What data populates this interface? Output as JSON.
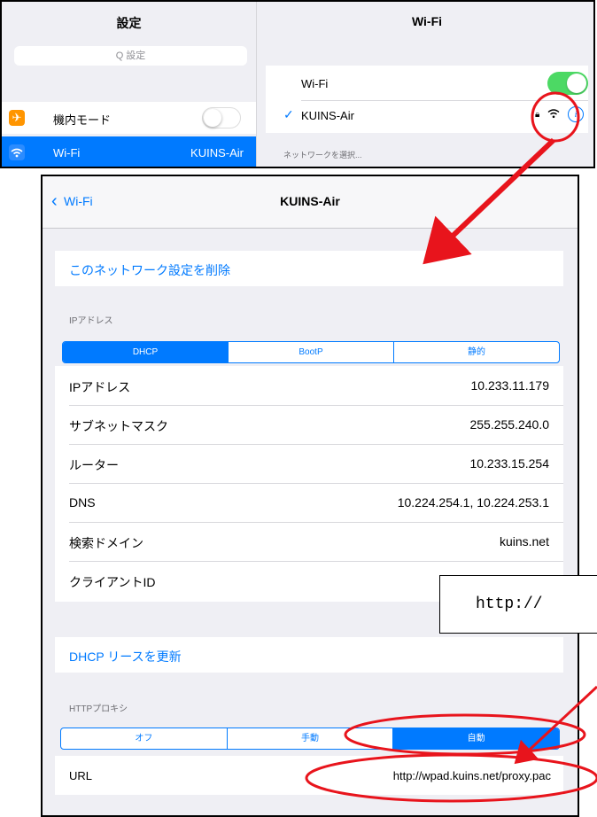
{
  "top": {
    "left_title": "設定",
    "search_placeholder": "Q 設定",
    "airplane_label": "機内モード",
    "wifi_label": "Wi-Fi",
    "wifi_network": "KUINS-Air",
    "right_title": "Wi-Fi",
    "wifi_toggle_label": "Wi-Fi",
    "connected_network": "KUINS-Air",
    "choose_network": "ネットワークを選択..."
  },
  "detail": {
    "back_label": "Wi-Fi",
    "title": "KUINS-Air",
    "forget_label": "このネットワーク設定を削除",
    "ip_section": "IPアドレス",
    "ip_modes": [
      "DHCP",
      "BootP",
      "静的"
    ],
    "ip_mode_selected": "DHCP",
    "rows": [
      {
        "key": "IPアドレス",
        "value": "10.233.11.179"
      },
      {
        "key": "サブネットマスク",
        "value": "255.255.240.0"
      },
      {
        "key": "ルーター",
        "value": "10.233.15.254"
      },
      {
        "key": "DNS",
        "value": "10.224.254.1, 10.224.253.1"
      },
      {
        "key": "検索ドメイン",
        "value": "kuins.net"
      },
      {
        "key": "クライアントID",
        "value": ""
      }
    ],
    "renew_label": "DHCP リースを更新",
    "proxy_section": "HTTPプロキシ",
    "proxy_modes": [
      "オフ",
      "手動",
      "自動"
    ],
    "proxy_mode_selected": "自動",
    "url_key": "URL",
    "url_value": "http://wpad.kuins.net/proxy.pac"
  },
  "callout_text": "http://",
  "colors": {
    "accent": "#007aff",
    "toggle_on": "#4cd964",
    "annotation": "#e8141c",
    "airplane": "#ff9500"
  }
}
